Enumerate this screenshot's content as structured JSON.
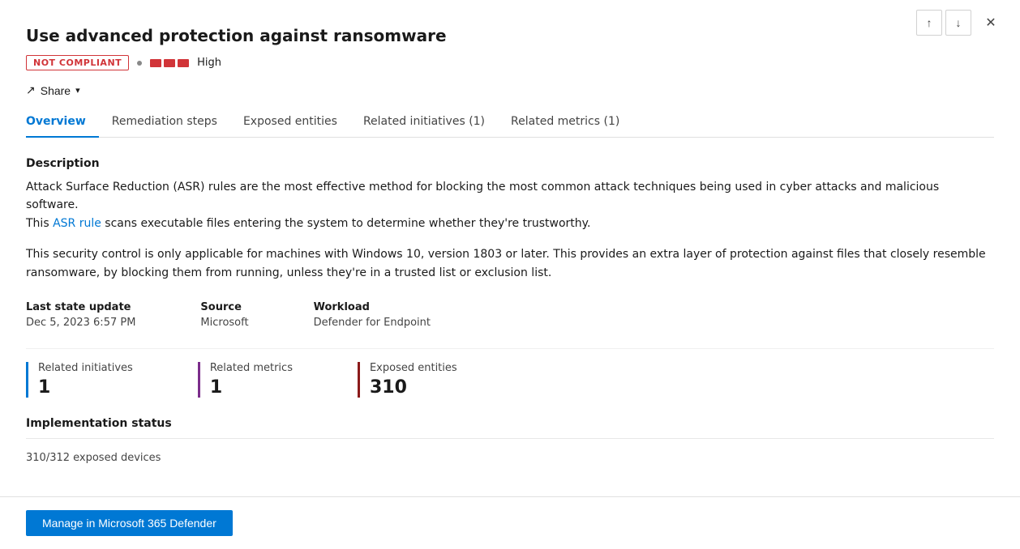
{
  "panel": {
    "title": "Use advanced protection against ransomware",
    "status_badge": "NOT COMPLIANT",
    "severity_label": "High",
    "severity_bars": 3,
    "share_label": "Share",
    "tabs": [
      {
        "id": "overview",
        "label": "Overview",
        "active": true
      },
      {
        "id": "remediation",
        "label": "Remediation steps",
        "active": false
      },
      {
        "id": "exposed",
        "label": "Exposed entities",
        "active": false
      },
      {
        "id": "initiatives",
        "label": "Related initiatives (1)",
        "active": false
      },
      {
        "id": "metrics",
        "label": "Related metrics (1)",
        "active": false
      }
    ]
  },
  "overview": {
    "description_section": "Description",
    "description_p1": "Attack Surface Reduction (ASR) rules are the most effective method for blocking the most common attack techniques being used in cyber attacks and malicious software.",
    "description_link_text": "ASR rule",
    "description_p1_suffix": " scans executable files entering the system to determine whether they're trustworthy.",
    "description_prefix": "This ",
    "description_p2": "This security control is only applicable for machines with Windows 10, version 1803 or later. This provides an extra layer of protection against files that closely resemble ransomware, by blocking them from running, unless they're in a trusted list or exclusion list.",
    "meta": {
      "last_state_label": "Last state update",
      "last_state_value": "Dec 5, 2023 6:57 PM",
      "source_label": "Source",
      "source_value": "Microsoft",
      "workload_label": "Workload",
      "workload_value": "Defender for Endpoint"
    },
    "stats": [
      {
        "label": "Related initiatives",
        "value": "1",
        "color": "blue"
      },
      {
        "label": "Related metrics",
        "value": "1",
        "color": "purple"
      },
      {
        "label": "Exposed entities",
        "value": "310",
        "color": "dark-red"
      }
    ],
    "impl_section": "Implementation status",
    "impl_value": "310/312 exposed devices"
  },
  "footer": {
    "manage_btn_label": "Manage in Microsoft 365 Defender"
  },
  "nav": {
    "up_icon": "↑",
    "down_icon": "↓",
    "close_icon": "✕"
  }
}
